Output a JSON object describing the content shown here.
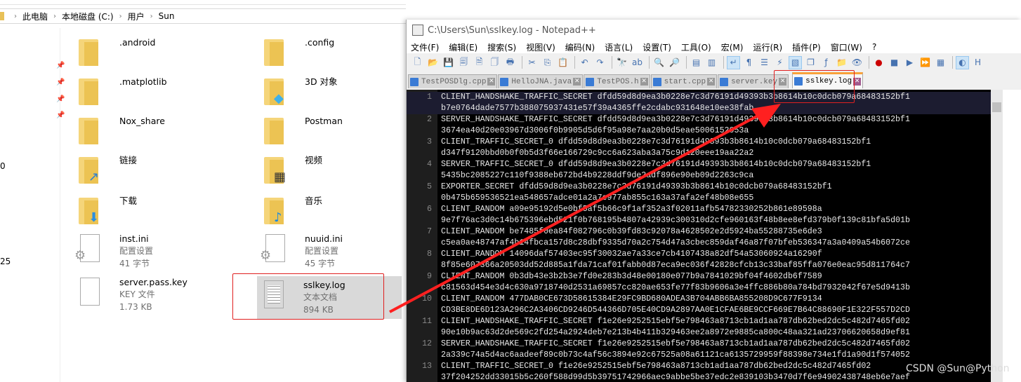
{
  "explorer": {
    "breadcrumb": [
      "此电脑",
      "本地磁盘 (C:)",
      "用户",
      "Sun"
    ],
    "left_fragments": [
      "0",
      "25"
    ],
    "items": [
      {
        "name": ".android",
        "icon": "folder-icon"
      },
      {
        "name": ".config",
        "icon": "folder-icon"
      },
      {
        "name": ".matplotlib",
        "icon": "folder-icon"
      },
      {
        "name": "3D 对象",
        "icon": "3d-objects-folder-icon"
      },
      {
        "name": "Nox_share",
        "icon": "folder-icon"
      },
      {
        "name": "Postman",
        "icon": "folder-icon"
      },
      {
        "name": "链接",
        "icon": "links-folder-icon"
      },
      {
        "name": "视频",
        "icon": "videos-folder-icon"
      },
      {
        "name": "下载",
        "icon": "downloads-folder-icon"
      },
      {
        "name": "音乐",
        "icon": "music-folder-icon"
      },
      {
        "name": "inst.ini",
        "type": "配置设置",
        "size": "41 字节",
        "icon": "settings-file-icon"
      },
      {
        "name": "nuuid.ini",
        "type": "配置设置",
        "size": "45 字节",
        "icon": "settings-file-icon"
      },
      {
        "name": "server.pass.key",
        "type": "KEY 文件",
        "size": "1.73 KB",
        "icon": "file-icon"
      },
      {
        "name": "sslkey.log",
        "type": "文本文档",
        "size": "894 KB",
        "icon": "text-file-icon",
        "selected": true
      }
    ]
  },
  "notepad": {
    "title": "C:\\Users\\Sun\\sslkey.log - Notepad++",
    "menu": [
      "文件(F)",
      "编辑(E)",
      "搜索(S)",
      "视图(V)",
      "编码(N)",
      "语言(L)",
      "设置(T)",
      "工具(O)",
      "宏(M)",
      "运行(R)",
      "插件(P)",
      "窗口(W)",
      "?"
    ],
    "tabs": [
      {
        "label": "TestPOSDlg.cpp"
      },
      {
        "label": "HelloJNA.java"
      },
      {
        "label": "TestPOS.h"
      },
      {
        "label": "start.cpp"
      },
      {
        "label": "server.key"
      },
      {
        "label": "sslkey.log",
        "active": true
      }
    ],
    "lines": [
      {
        "num": "1",
        "text": [
          "CLIENT_HANDSHAKE_TRAFFIC_SECRET dfdd59d8d9ea3b0228e7c3d76191d49393b3b8614b10c0dcb079a68483152bf1",
          "b7e0764dade7577b388075937431e57f39a4365ffe2cdabc931648e10ee38fab"
        ]
      },
      {
        "num": "2",
        "text": [
          "SERVER_HANDSHAKE_TRAFFIC_SECRET dfdd59d8d9ea3b0228e7c3d76191d49393b3b8614b10c0dcb079a68483152bf1",
          "3674ea40d20e03967d3006f0b9905d5d6f95a98e7aa20b0d5eae5006152053a"
        ]
      },
      {
        "num": "3",
        "text": [
          "CLIENT_TRAFFIC_SECRET_0 dfdd59d8d9ea3b0228e7c3d76191d49393b3b8614b10c0dcb079a68483152bf1",
          "d347f9120bbd0b0f0b5d3f66e166729c9cc6a623aba3a75c9d120eee19aa22a2"
        ]
      },
      {
        "num": "4",
        "text": [
          "SERVER_TRAFFIC_SECRET_0 dfdd59d8d9ea3b0228e7c3d76191d49393b3b8614b10c0dcb079a68483152bf1",
          "5435bc2085227c110f9388eb672bd4b9228ddf9de2adf896e90eb09d2263c9ca"
        ]
      },
      {
        "num": "5",
        "text": [
          "EXPORTER_SECRET dfdd59d8d9ea3b0228e7c3d76191d49393b3b8614b10c0dcb079a68483152bf1",
          "0b475b659536521ea548657adce01a2a7e977ab855c163a37afa2ef48b08e655"
        ]
      },
      {
        "num": "6",
        "text": [
          "CLIENT_RANDOM a09e95192d5e0bf5af5b66c9f1af352a3f02011afb54782330252b861e89598a",
          "9e7f76ac3d0c14b675396ebd521f0b768195b4807a42939c300310d2cfe960163f48b8ee8efd379b0f139c81bfa5d01b"
        ]
      },
      {
        "num": "7",
        "text": [
          "CLIENT_RANDOM be7485f0ea84f082796c0b39fd83c92078a4628502e2d5924ba55288735e6de3",
          "c5ea0ae48747af4b14fbca157d8c28dbf9335d70a2c754d47a3cbec859daf46a87f07bfeb536347a3a0409a54b6072ce"
        ]
      },
      {
        "num": "8",
        "text": [
          "CLIENT_RANDOM 14096daf57403ec95f30032ae7a33ce7cb4107438a82df54a53060924a16290f",
          "8f85e607366a20503dd52d885a1fda71caf01fabb0d87eca9ec036f42828cfcb13c33baf85ffa076e0eac95d811764c7"
        ]
      },
      {
        "num": "9",
        "text": [
          "CLIENT_RANDOM 0b3db43e3b2b3e7fd0e283b3d48e00180e077b9a7841029bf04f4602db6f7589",
          "c81563d454e3d4c630a9718740d2531a69857cc820ae653fe77f83b9606a3e4ffc886b80a784bd7932042f67e5d9413b"
        ]
      },
      {
        "num": "10",
        "text": [
          "CLIENT_RANDOM 477DAB0CE673D58615384E29FC9BD680ADEA3B704ABB6BA855208D9C677F9134",
          "CD3BE8DE6D123A296C2A3406CD9246D544366D705E40CD9A2897AA0E1CFAE6BE9CCF669E7B64C88690F1E322F557D2CD"
        ]
      },
      {
        "num": "11",
        "text": [
          "CLIENT_HANDSHAKE_TRAFFIC_SECRET f1e26e9252515ebf5e798463a8713cb1ad1aa787db62bed2dc5c482d7465fd02",
          "90e10b9ac63d2de569c2fd254a2924deb7e213b4b411b329463ee2a8972e9885ca800c48aa321ad23706620658d9ef81"
        ]
      },
      {
        "num": "12",
        "text": [
          "SERVER_HANDSHAKE_TRAFFIC_SECRET f1e26e9252515ebf5e798463a8713cb1ad1aa787db62bed2dc5c482d7465fd02",
          "2a339c74a5d4ac6aadeef89c0b73c4af56c3894e92c67525a08a61121ca6135729959f88398e734e1fd1a90d1f574052"
        ]
      },
      {
        "num": "13",
        "text": [
          "CLIENT_TRAFFIC_SECRET_0 f1e26e9252515ebf5e798463a8713cb1ad1aa787db62bed2dc5c482d7465fd02",
          "37f204252dd33015b5c260f588d99d5b39751742966aec9abbe5be37edc2e839103b3470d7f6e94902438748eb6e7aef"
        ]
      }
    ]
  },
  "watermark": "CSDN @Sun@Python",
  "colors": {
    "highlight_box": "#e02020",
    "arrow": "#ff2020",
    "active_tab_accent": "#f9a23a",
    "editor_bg": "#000000"
  }
}
